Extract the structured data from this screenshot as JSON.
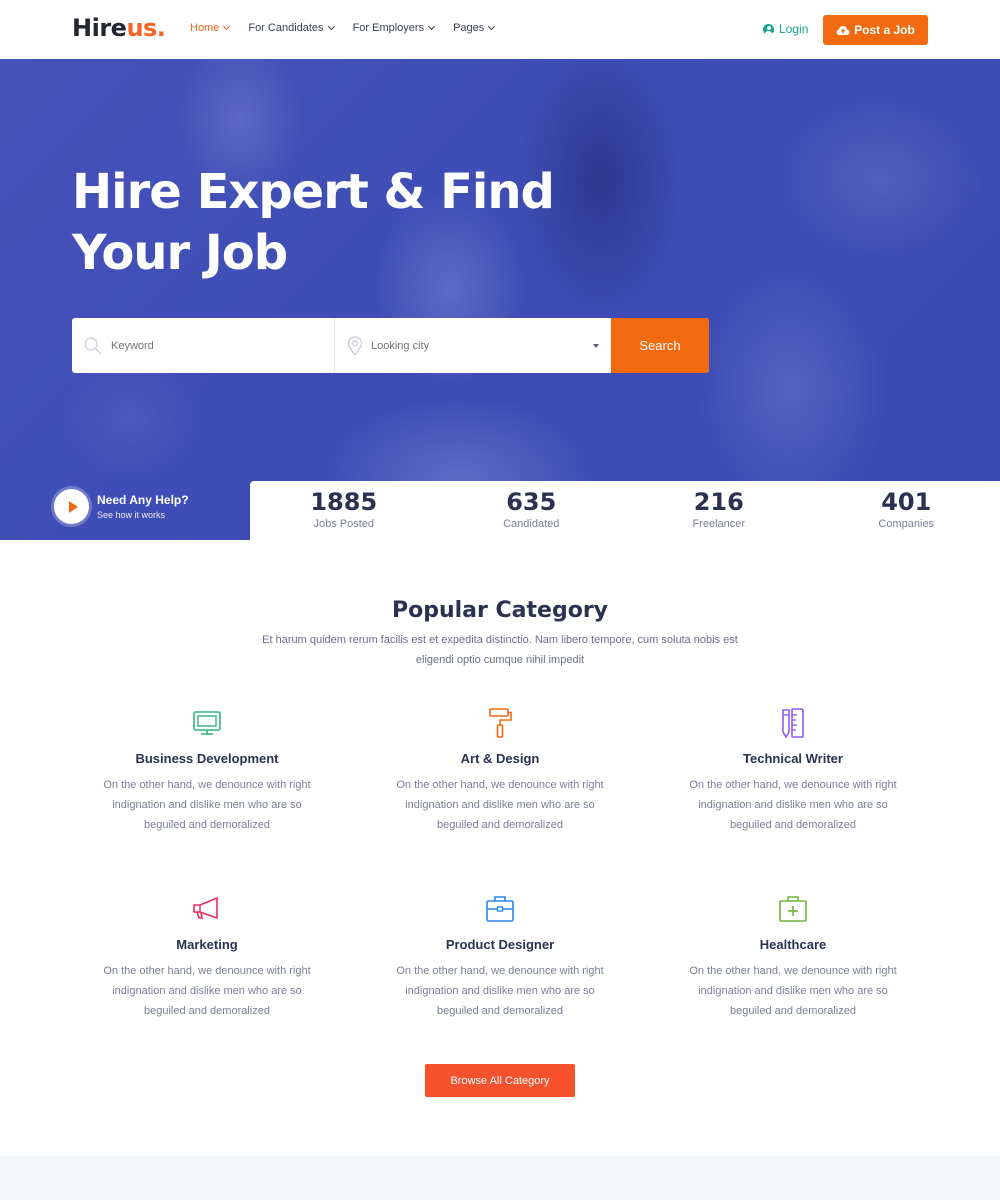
{
  "header": {
    "logo_main": "Hire",
    "logo_accent": "us.",
    "nav": [
      {
        "label": "Home",
        "active": true
      },
      {
        "label": "For Candidates",
        "active": false
      },
      {
        "label": "For Employers",
        "active": false
      },
      {
        "label": "Pages",
        "active": false
      }
    ],
    "login_label": "Login",
    "post_job_label": "Post a Job"
  },
  "hero": {
    "title_line1": "Hire Expert & Find",
    "title_line2": "Your Job",
    "search": {
      "keyword_placeholder": "Keyword",
      "city_placeholder": "Looking city",
      "button_label": "Search"
    },
    "help": {
      "title": "Need Any Help?",
      "subtitle": "See how it works"
    }
  },
  "stats": [
    {
      "value": "1885",
      "label": "Jobs Posted"
    },
    {
      "value": "635",
      "label": "Candidated"
    },
    {
      "value": "216",
      "label": "Freelancer"
    },
    {
      "value": "401",
      "label": "Companies"
    }
  ],
  "categories_section": {
    "title": "Popular Category",
    "description": "Et harum quidem rerum facilis est et expedita distinctio. Nam libero tempore, cum soluta nobis est eligendi optio cumque nihil impedit",
    "items": [
      {
        "title": "Business Development",
        "description": "On the other hand, we denounce with right indignation and dislike men who are so beguiled and demoralized",
        "icon": "monitor-icon",
        "color": "#2fb57f"
      },
      {
        "title": "Art & Design",
        "description": "On the other hand, we denounce with right indignation and dislike men who are so beguiled and demoralized",
        "icon": "paint-roller-icon",
        "color": "#f26a10"
      },
      {
        "title": "Technical Writer",
        "description": "On the other hand, we denounce with right indignation and dislike men who are so beguiled and demoralized",
        "icon": "pencil-ruler-icon",
        "color": "#8e5cf0"
      },
      {
        "title": "Marketing",
        "description": "On the other hand, we denounce with right indignation and dislike men who are so beguiled and demoralized",
        "icon": "megaphone-icon",
        "color": "#ea2c5b"
      },
      {
        "title": "Product Designer",
        "description": "On the other hand, we denounce with right indignation and dislike men who are so beguiled and demoralized",
        "icon": "briefcase-icon",
        "color": "#2a86e8"
      },
      {
        "title": "Healthcare",
        "description": "On the other hand, we denounce with right indignation and dislike men who are so beguiled and demoralized",
        "icon": "medical-kit-icon",
        "color": "#6fb43a"
      }
    ],
    "browse_label": "Browse All Category"
  },
  "colors": {
    "accent": "#f26a10",
    "hero_blue": "#3d4db5",
    "heading": "#2b3151",
    "login_green": "#14a38b"
  }
}
